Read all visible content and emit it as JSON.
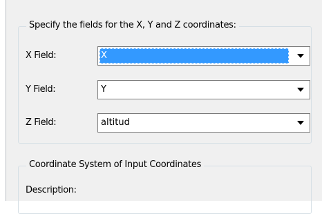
{
  "coords_group": {
    "title": "Specify the fields for the X, Y and Z coordinates:",
    "fields": [
      {
        "label": "X Field:",
        "value": "X"
      },
      {
        "label": "Y Field:",
        "value": "Y"
      },
      {
        "label": "Z Field:",
        "value": "altitud"
      }
    ]
  },
  "coord_system_group": {
    "title": "Coordinate System of Input Coordinates",
    "description_label": "Description:"
  },
  "colors": {
    "selection": "#3399ff",
    "panel_background": "#f0f0f0",
    "group_border": "#d5dfe5"
  },
  "icons": {
    "dropdown": "chevron-down-icon"
  }
}
